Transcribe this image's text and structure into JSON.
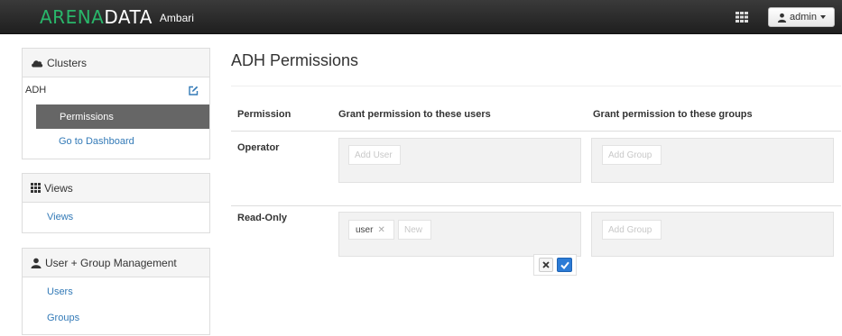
{
  "header": {
    "brand_primary": "ARENA",
    "brand_secondary": "DATA",
    "brand_sub": "Ambari",
    "apps_icon": "grid-icon",
    "user_label": "admin",
    "colors": {
      "brand_green": "#29b66a",
      "navbar": "#2b2b2b"
    }
  },
  "sidebar": {
    "clusters": {
      "heading": "Clusters",
      "icon": "cloud-icon",
      "cluster_name": "ADH",
      "items": [
        {
          "label": "Permissions",
          "active": true
        },
        {
          "label": "Go to Dashboard",
          "active": false
        }
      ]
    },
    "views": {
      "heading": "Views",
      "icon": "th-grid-icon",
      "items": [
        {
          "label": "Views"
        }
      ]
    },
    "user_management": {
      "heading": "User + Group Management",
      "icon": "user-icon",
      "items": [
        {
          "label": "Users"
        },
        {
          "label": "Groups"
        }
      ]
    }
  },
  "main": {
    "title": "ADH Permissions",
    "columns": [
      "Permission",
      "Grant permission to these users",
      "Grant permission to these groups"
    ],
    "rows": [
      {
        "permission": "Operator",
        "users": [],
        "users_placeholder": "Add User",
        "groups": [],
        "groups_placeholder": "Add Group"
      },
      {
        "permission": "Read-Only",
        "users": [
          "user"
        ],
        "users_placeholder": "New",
        "groups": [],
        "groups_placeholder": "Add Group"
      }
    ],
    "edit_controls": {
      "cancel_icon": "close-icon",
      "confirm_icon": "check-icon"
    }
  }
}
